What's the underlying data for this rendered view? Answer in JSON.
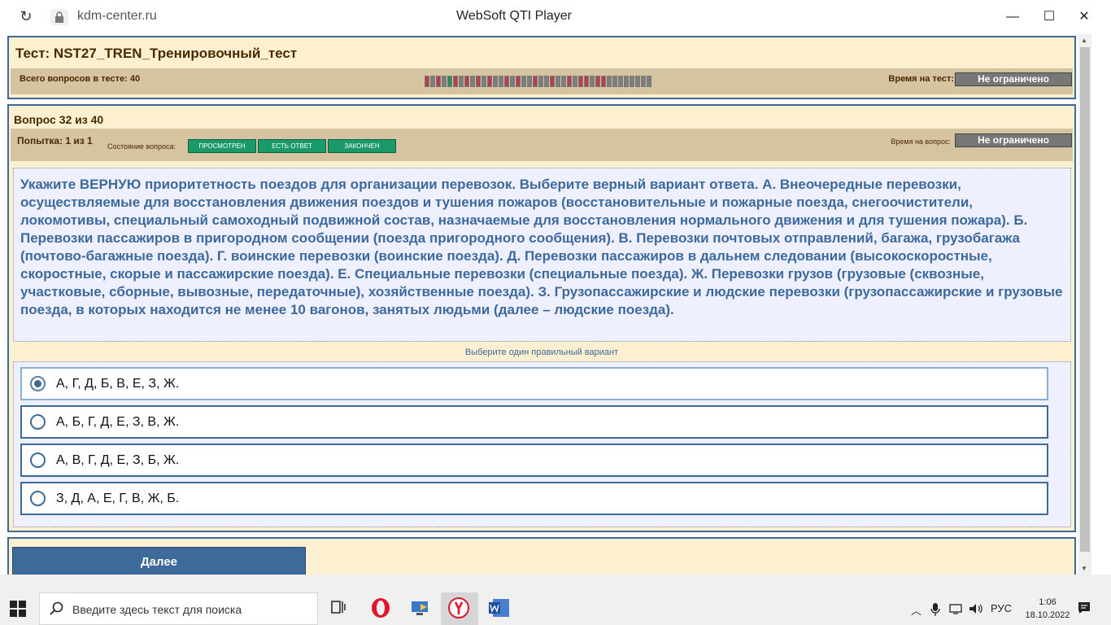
{
  "browser": {
    "url": "kdm-center.ru",
    "title": "WebSoft QTI Player",
    "minimize": "—",
    "maximize": "☐",
    "close": "✕"
  },
  "test": {
    "title": "Тест: NST27_TREN_Тренировочный_тест",
    "total_label": "Всего вопросов в тесте: 40",
    "time_label": "Время на тест:",
    "time_value": "Не ограничено",
    "question_strip": [
      "red",
      "gray",
      "red",
      "gray",
      "green",
      "red",
      "gray",
      "red",
      "gray",
      "red",
      "gray",
      "red",
      "gray",
      "gray",
      "red",
      "gray",
      "red",
      "gray",
      "gray",
      "red",
      "gray",
      "gray",
      "red",
      "gray",
      "gray",
      "red",
      "gray",
      "red",
      "red",
      "gray",
      "red",
      "red",
      "gray",
      "gray",
      "gray",
      "gray",
      "gray",
      "gray",
      "gray",
      "gray"
    ]
  },
  "question": {
    "title": "Вопрос 32 из 40",
    "attempt": "Попытка: 1 из 1",
    "state_label": "Состояние вопроса:",
    "states": [
      "ПРОСМОТРЕН",
      "ЕСТЬ ОТВЕТ",
      "ЗАКОНЧЕН"
    ],
    "time_label": "Время на вопрос:",
    "time_value": "Не ограничено",
    "text": "Укажите ВЕРНУЮ приоритетность поездов для организации перевозок. Выберите верный вариант ответа. А. Внеочередные перевозки, осуществляемые для восстановления движения поездов и тушения пожаров (восстановительные и пожарные поезда, снегоочистители, локомотивы, специальный самоходный подвижной состав, назначаемые для восстановления нормального движения и для тушения пожара). Б. Перевозки пассажиров в пригородном сообщении (поезда пригородного сообщения). В. Перевозки почтовых отправлений, багажа, грузобагажа (почтово-багажные поезда). Г. воинские перевозки (воинские поезда). Д. Перевозки пассажиров в дальнем следовании (высокоскоростные, скоростные, скорые и пассажирские поезда). Е. Специальные перевозки (специальные поезда). Ж. Перевозки грузов (грузовые (сквозные, участковые, сборные, вывозные, передаточные), хозяйственные поезда). З. Грузопассажирские и людские перевозки (грузопассажирские и грузовые поезда, в которых находится не менее 10 вагонов, занятых людьми (далее – людские поезда).",
    "hint": "Выберите один правильный вариант",
    "options": [
      {
        "label": "А, Г, Д, Б, В, Е, З, Ж.",
        "selected": true
      },
      {
        "label": "А, Б, Г, Д, Е, З, В, Ж.",
        "selected": false
      },
      {
        "label": "А, В, Г, Д, Е, З, Б, Ж.",
        "selected": false
      },
      {
        "label": "З, Д, А, Е, Г, В, Ж, Б.",
        "selected": false
      }
    ],
    "next_label": "Далее"
  },
  "taskbar": {
    "search_placeholder": "Введите здесь текст для поиска",
    "lang": "РУС",
    "time": "1:06",
    "date": "18.10.2022"
  }
}
